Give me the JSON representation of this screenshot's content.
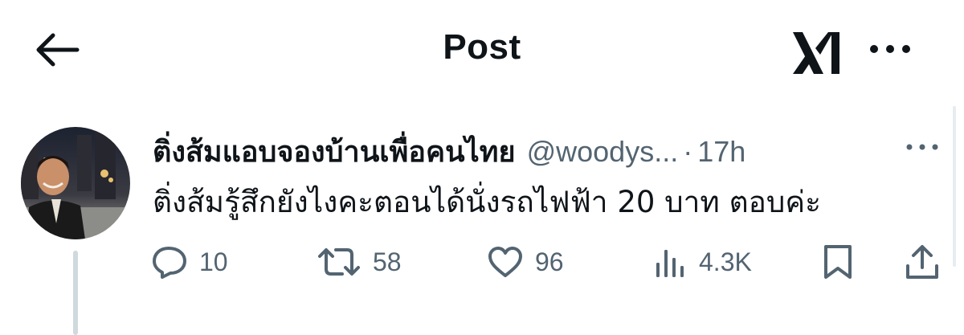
{
  "header": {
    "title": "Post",
    "back_icon": "back-arrow-icon",
    "grok_icon": "grok-logo-icon",
    "more_icon": "more-horizontal-icon"
  },
  "post": {
    "display_name": "ติ่งส้มแอบจองบ้านเพื่อคนไทย",
    "handle": "@woodys...",
    "separator": "·",
    "time": "17h",
    "text": "ติ่งส้มรู้สึกยังไงคะตอนได้นั่งรถไฟฟ้า 20 บาท ตอบค่ะ",
    "avatar": "user-avatar-photo"
  },
  "actions": {
    "reply_count": "10",
    "repost_count": "58",
    "like_count": "96",
    "views_count": "4.3K"
  },
  "colors": {
    "text_primary": "#0f1419",
    "text_secondary": "#536471",
    "thread_line": "#cfd9de"
  }
}
